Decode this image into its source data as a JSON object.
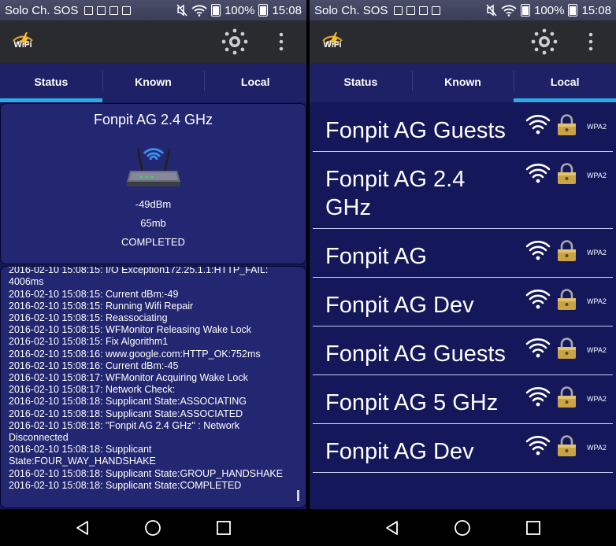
{
  "status_bar": {
    "carrier": "Solo Ch. SOS",
    "battery": "100%",
    "time": "15:08"
  },
  "app": {
    "tabs": [
      {
        "label": "Status"
      },
      {
        "label": "Known"
      },
      {
        "label": "Local"
      }
    ]
  },
  "left_screen": {
    "active_tab": "Status",
    "status_card": {
      "ssid": "Fonpit AG 2.4 GHz",
      "signal": "-49dBm",
      "speed": "65mb",
      "state": "COMPLETED"
    },
    "log_lines": [
      "2016-02-10 15:08:15: I/O Exception172.25.1.1:HTTP_FAIL:",
      "4006ms",
      "2016-02-10 15:08:15: Current dBm:-49",
      "2016-02-10 15:08:15: Running Wifi Repair",
      "2016-02-10 15:08:15: Reassociating",
      "2016-02-10 15:08:15: WFMonitor Releasing Wake Lock",
      "2016-02-10 15:08:15: Fix Algorithm1",
      "2016-02-10 15:08:16: www.google.com:HTTP_OK:752ms",
      "2016-02-10 15:08:16: Current dBm:-45",
      "2016-02-10 15:08:17: WFMonitor Acquiring Wake Lock",
      "2016-02-10 15:08:17: Network Check:",
      "2016-02-10 15:08:18: Supplicant State:ASSOCIATING",
      "2016-02-10 15:08:18: Supplicant State:ASSOCIATED",
      "2016-02-10 15:08:18: \"Fonpit AG 2.4 GHz\" : Network",
      "Disconnected",
      "2016-02-10 15:08:18: Supplicant",
      "State:FOUR_WAY_HANDSHAKE",
      "2016-02-10 15:08:18: Supplicant State:GROUP_HANDSHAKE",
      "2016-02-10 15:08:18: Supplicant State:COMPLETED"
    ]
  },
  "right_screen": {
    "active_tab": "Local",
    "networks": [
      {
        "name": "Fonpit AG Guests",
        "security": "WPA2"
      },
      {
        "name": "Fonpit AG 2.4 GHz",
        "security": "WPA2"
      },
      {
        "name": "Fonpit AG",
        "security": "WPA2"
      },
      {
        "name": "Fonpit AG Dev",
        "security": "WPA2"
      },
      {
        "name": "Fonpit AG Guests",
        "security": "WPA2"
      },
      {
        "name": "Fonpit AG 5 GHz",
        "security": "WPA2"
      },
      {
        "name": "Fonpit AG Dev",
        "security": "WPA2"
      }
    ]
  },
  "colors": {
    "background": "#14175a",
    "panel": "#232670",
    "tab_bar": "#1e2166",
    "tab_indicator": "#2fa8e6",
    "app_bar": "#292b2e",
    "wifi_icon": "#ffffff",
    "lock_gold": "#c9a446"
  }
}
